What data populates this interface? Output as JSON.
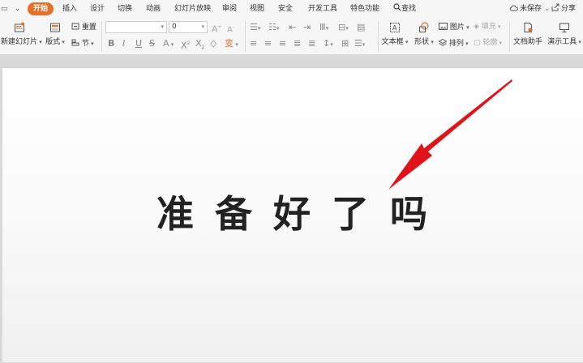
{
  "menu": {
    "quick_access": [
      "▭",
      "⌄"
    ],
    "tabs": [
      "开始",
      "插入",
      "设计",
      "切换",
      "动画",
      "幻灯片放映",
      "审阅",
      "视图",
      "安全",
      "开发工具",
      "特色功能"
    ],
    "search": "查找",
    "unsaved": "未保存",
    "share": "分享"
  },
  "ribbon": {
    "new_slide": "新建幻灯片",
    "layout": "版式",
    "reset": "重置",
    "section": "节",
    "font_size_value": "0",
    "textbox": "文本框",
    "shape": "形状",
    "picture": "图片",
    "fill": "填充",
    "arrange": "排列",
    "outline": "轮廓",
    "doc_assistant": "文档助手",
    "present_tools": "演示工具"
  },
  "slide": {
    "text": "准备好了吗",
    "arrow_color": "#e0131b"
  },
  "colors": {
    "accent": "#e5702b",
    "arrow": "#e0131b"
  }
}
